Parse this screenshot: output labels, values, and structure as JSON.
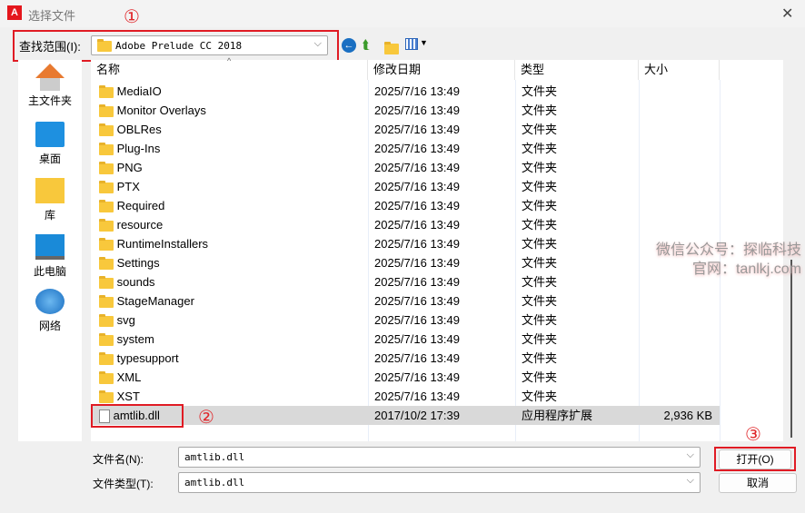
{
  "window": {
    "title": "选择文件",
    "close": "✕"
  },
  "annotations": [
    "①",
    "②",
    "③"
  ],
  "toolbar": {
    "lookin_label": "查找范围(I):",
    "lookin_value": "Adobe Prelude CC 2018"
  },
  "sidebar": {
    "items": [
      {
        "label": "主文件夹"
      },
      {
        "label": "桌面"
      },
      {
        "label": "库"
      },
      {
        "label": "此电脑"
      },
      {
        "label": "网络"
      }
    ]
  },
  "list": {
    "columns": [
      "名称",
      "修改日期",
      "类型",
      "大小"
    ],
    "rows": [
      {
        "name": "MediaIO",
        "date": "2025/7/16 13:49",
        "type": "文件夹",
        "size": ""
      },
      {
        "name": "Monitor Overlays",
        "date": "2025/7/16 13:49",
        "type": "文件夹",
        "size": ""
      },
      {
        "name": "OBLRes",
        "date": "2025/7/16 13:49",
        "type": "文件夹",
        "size": ""
      },
      {
        "name": "Plug-Ins",
        "date": "2025/7/16 13:49",
        "type": "文件夹",
        "size": ""
      },
      {
        "name": "PNG",
        "date": "2025/7/16 13:49",
        "type": "文件夹",
        "size": ""
      },
      {
        "name": "PTX",
        "date": "2025/7/16 13:49",
        "type": "文件夹",
        "size": ""
      },
      {
        "name": "Required",
        "date": "2025/7/16 13:49",
        "type": "文件夹",
        "size": ""
      },
      {
        "name": "resource",
        "date": "2025/7/16 13:49",
        "type": "文件夹",
        "size": ""
      },
      {
        "name": "RuntimeInstallers",
        "date": "2025/7/16 13:49",
        "type": "文件夹",
        "size": ""
      },
      {
        "name": "Settings",
        "date": "2025/7/16 13:49",
        "type": "文件夹",
        "size": ""
      },
      {
        "name": "sounds",
        "date": "2025/7/16 13:49",
        "type": "文件夹",
        "size": ""
      },
      {
        "name": "StageManager",
        "date": "2025/7/16 13:49",
        "type": "文件夹",
        "size": ""
      },
      {
        "name": "svg",
        "date": "2025/7/16 13:49",
        "type": "文件夹",
        "size": ""
      },
      {
        "name": "system",
        "date": "2025/7/16 13:49",
        "type": "文件夹",
        "size": ""
      },
      {
        "name": "typesupport",
        "date": "2025/7/16 13:49",
        "type": "文件夹",
        "size": ""
      },
      {
        "name": "XML",
        "date": "2025/7/16 13:49",
        "type": "文件夹",
        "size": ""
      },
      {
        "name": "XST",
        "date": "2025/7/16 13:49",
        "type": "文件夹",
        "size": ""
      },
      {
        "name": "amtlib.dll",
        "date": "2017/10/2 17:39",
        "type": "应用程序扩展",
        "size": "2,936 KB",
        "file": true
      }
    ]
  },
  "footer": {
    "filename_label": "文件名(N):",
    "filename_value": "amtlib.dll",
    "filetype_label": "文件类型(T):",
    "filetype_value": "amtlib.dll",
    "open": "打开(O)",
    "cancel": "取消"
  },
  "watermark": {
    "line1": "微信公众号：探临科技",
    "line2": "官网：tanlkj.com"
  }
}
